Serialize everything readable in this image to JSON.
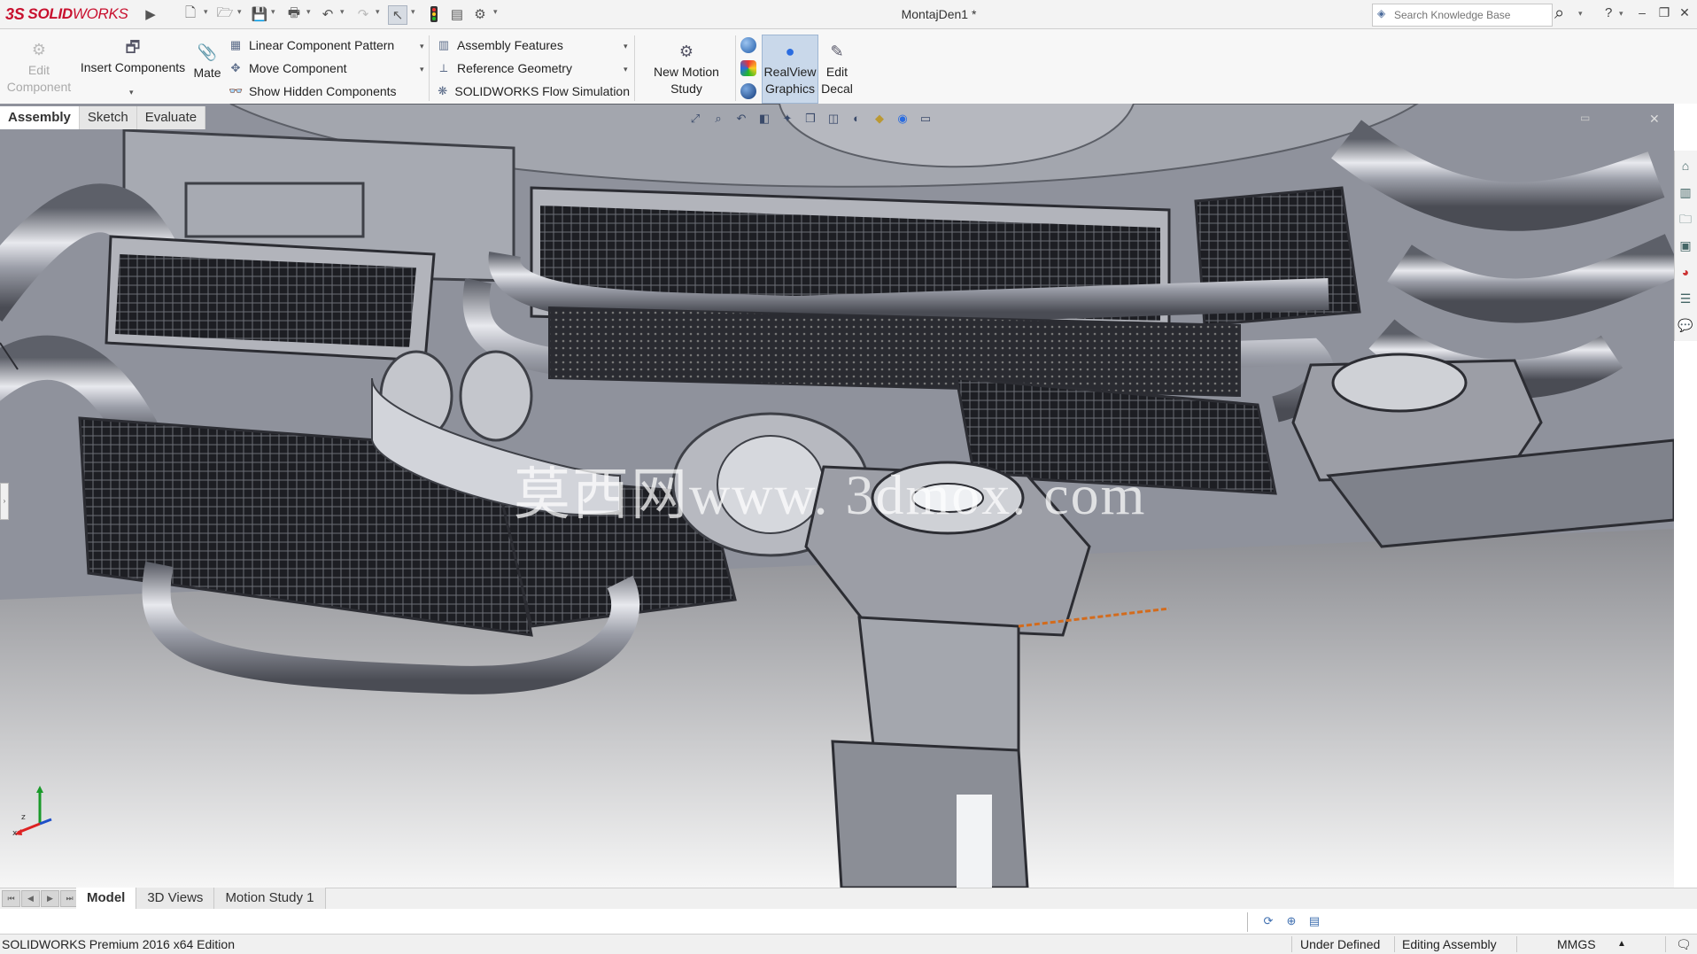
{
  "app": {
    "brand_prefix": "3S",
    "brand_name": "SOLID",
    "brand_suffix": "WORKS",
    "document_title": "MontajDen1 *"
  },
  "quick_access": {
    "icons": [
      "play-arrow-icon",
      "new-document-icon",
      "open-folder-icon",
      "save-icon",
      "print-icon",
      "undo-icon",
      "redo-icon",
      "select-pointer-icon",
      "traffic-light-icon",
      "file-properties-icon",
      "options-gear-icon"
    ]
  },
  "search": {
    "placeholder": "Search Knowledge Base",
    "help_label": "?"
  },
  "window_controls": {
    "minimize": "–",
    "restore": "❐",
    "close": "✕"
  },
  "ribbon": {
    "edit_component": "Edit\nComponent",
    "insert_components": "Insert Components",
    "mate": "Mate",
    "rows1": [
      {
        "label": "Linear Component Pattern",
        "icon": "linear-pattern-icon"
      },
      {
        "label": "Move Component",
        "icon": "move-component-icon"
      },
      {
        "label": "Show Hidden Components",
        "icon": "show-hidden-icon"
      }
    ],
    "rows2": [
      {
        "label": "Assembly Features",
        "icon": "assembly-features-icon"
      },
      {
        "label": "Reference Geometry",
        "icon": "reference-geometry-icon"
      },
      {
        "label": "SOLIDWORKS Flow Simulation",
        "icon": "flow-simulation-icon"
      }
    ],
    "new_motion_study": "New Motion\nStudy",
    "realview_graphics": "RealView\nGraphics",
    "edit_decal": "Edit\nDecal"
  },
  "command_tabs": [
    "Assembly",
    "Sketch",
    "Evaluate"
  ],
  "command_tab_active": "Assembly",
  "viewport": {
    "watermark": "莫西网www. 3dmox. com"
  },
  "bottom_tabs": [
    "Model",
    "3D Views",
    "Motion Study 1"
  ],
  "bottom_tab_active": "Model",
  "statusbar": {
    "edition": "SOLIDWORKS Premium 2016 x64 Edition",
    "state": "Under Defined",
    "mode": "Editing Assembly",
    "units": "MMGS",
    "units_caret": "▲"
  },
  "colors": {
    "brand_red": "#c8102e",
    "realview_active_bg": "#c9d8ea",
    "viewport_steel": "#9a9ca6"
  }
}
